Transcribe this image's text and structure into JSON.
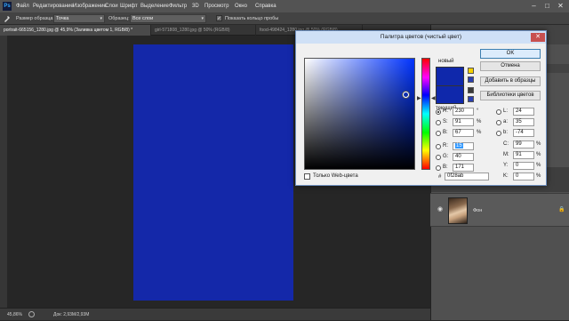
{
  "menubar": {
    "logo": "Ps",
    "items": [
      "Файл",
      "Редактирование",
      "Изображение",
      "Слои",
      "Шрифт",
      "Выделение",
      "Фильтр",
      "3D",
      "Просмотр",
      "Окно",
      "Справка"
    ],
    "minimize": "–",
    "maximize": "□",
    "close": "✕"
  },
  "options": {
    "sample_size_label": "Размер образца:",
    "sample_size_value": "Точка",
    "sample_label": "Образец:",
    "sample_value": "Все слои",
    "show_ring_label": "Показать кольцо пробы"
  },
  "tabs": [
    {
      "label": "portrait-665156_1280.jpg @ 45,9% (Заливка цветом 1, RGB/8) *",
      "active": true
    },
    {
      "label": "girl-571808_1280.jpg @ 50% (RGB/8)",
      "active": false
    },
    {
      "label": "food-498424_1280.jpg @ 50% (RGB/8)",
      "active": false
    }
  ],
  "status": {
    "zoom": "45,86%",
    "doc": "Док: 2,93М/2,93М"
  },
  "layers": {
    "name": "Фон"
  },
  "dialog": {
    "title": "Палитра цветов (чистый цвет)",
    "new_label": "новый",
    "current_label": "текущий",
    "buttons": {
      "ok": "OK",
      "cancel": "Отмена",
      "add_swatch": "Добавить в образцы",
      "libraries": "Библиотеки цветов"
    },
    "web_only_label": "Только Web-цвета",
    "hex_label": "#",
    "hex_value": "0f28ab",
    "color_new": "#0f28ab",
    "color_current": "#0f28ab",
    "hsb": [
      {
        "label": "H:",
        "value": "230",
        "unit": "°",
        "selected": true
      },
      {
        "label": "S:",
        "value": "91",
        "unit": "%",
        "selected": false
      },
      {
        "label": "B:",
        "value": "67",
        "unit": "%",
        "selected": false
      }
    ],
    "rgb": [
      {
        "label": "R:",
        "value": "15",
        "selected": false,
        "highlight": true
      },
      {
        "label": "G:",
        "value": "40",
        "selected": false,
        "highlight": false
      },
      {
        "label": "B:",
        "value": "171",
        "selected": false,
        "highlight": false
      }
    ],
    "lab": [
      {
        "label": "L:",
        "value": "24"
      },
      {
        "label": "a:",
        "value": "35"
      },
      {
        "label": "b:",
        "value": "-74"
      }
    ],
    "cmyk": [
      {
        "label": "C:",
        "value": "99",
        "unit": "%"
      },
      {
        "label": "M:",
        "value": "91",
        "unit": "%"
      },
      {
        "label": "Y:",
        "value": "0",
        "unit": "%"
      },
      {
        "label": "K:",
        "value": "0",
        "unit": "%"
      }
    ]
  },
  "colors": {
    "document_fill": "#1428a9",
    "accent": "#31a8ff"
  }
}
